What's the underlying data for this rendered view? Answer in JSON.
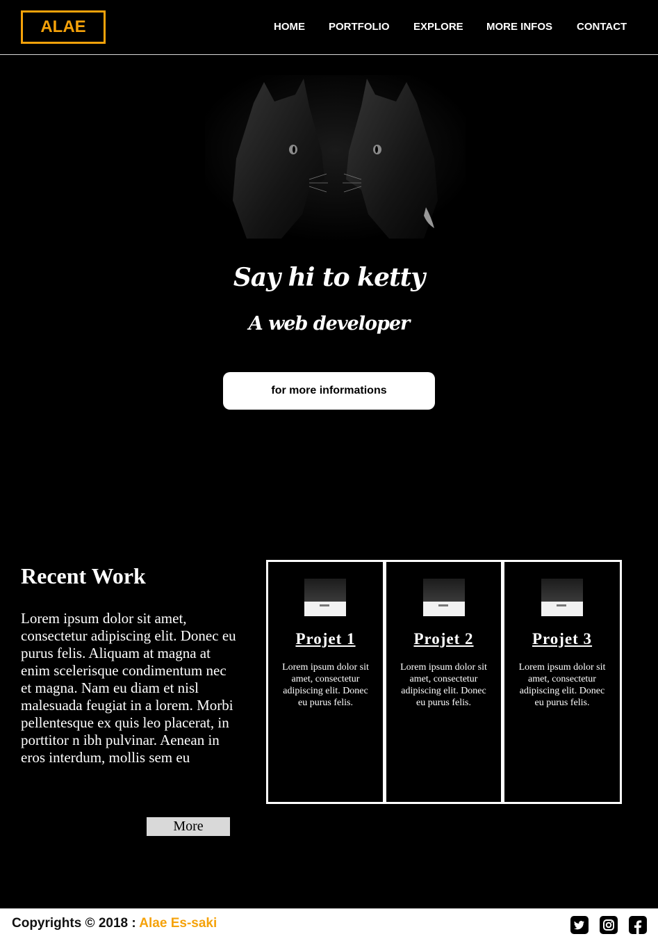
{
  "header": {
    "logo": "ALAE",
    "nav": [
      "HOME",
      "PORTFOLIO",
      "EXPLORE",
      "MORE INFOS",
      "CONTACT"
    ]
  },
  "hero": {
    "title": "Say hi to ketty",
    "subtitle": "A web developer",
    "button": "for more informations"
  },
  "recent_work": {
    "title": "Recent Work",
    "text": "Lorem ipsum dolor sit amet, consectetur adipiscing elit. Donec eu purus felis. Aliquam at magna at enim scelerisque condimentum nec et magna. Nam eu diam et nisl malesuada feugiat in a lorem. Morbi pellentesque ex quis leo placerat, in porttitor n ibh pulvinar. Aenean in eros interdum, mollis sem eu",
    "more": "More",
    "projects": [
      {
        "title": "Projet 1",
        "text": "Lorem ipsum dolor sit amet, consectetur adipiscing elit. Donec eu purus felis."
      },
      {
        "title": "Projet 2",
        "text": "Lorem ipsum dolor sit amet, consectetur adipiscing elit. Donec eu purus felis."
      },
      {
        "title": "Projet 3",
        "text": "Lorem ipsum dolor sit amet, consectetur adipiscing elit. Donec eu purus felis."
      }
    ]
  },
  "footer": {
    "copyright": "Copyrights © 2018 :",
    "name": "Alae Es-saki",
    "social": [
      "twitter-icon",
      "instagram-icon",
      "facebook-icon"
    ]
  },
  "colors": {
    "accent": "#f5a20a",
    "background": "#000000"
  }
}
